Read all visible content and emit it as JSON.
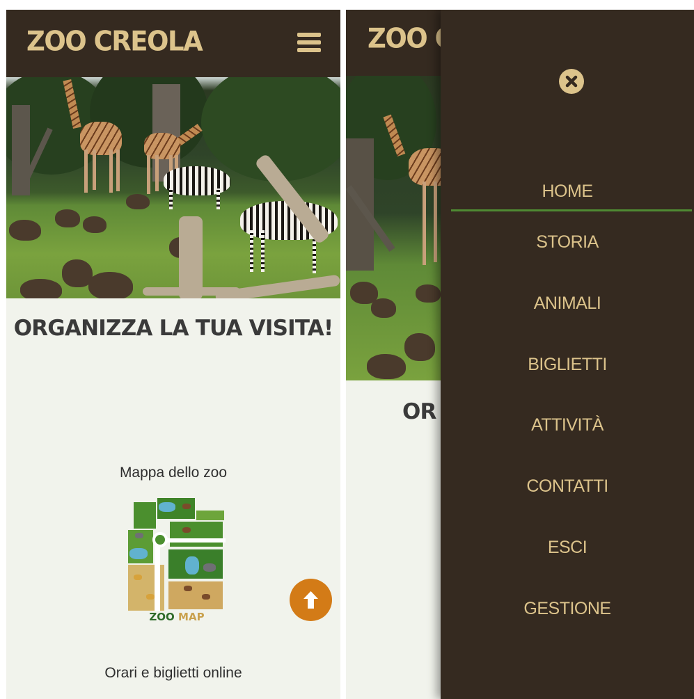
{
  "app": {
    "logo_text": "ZOO CREOLA",
    "colors": {
      "topbar": "#352a20",
      "brand_gold": "#dcc38b",
      "background": "#f1f3ec",
      "accent_orange": "#d37b17",
      "active_underline": "#4f8a33"
    }
  },
  "left_screen": {
    "menu_icon": "hamburger-icon",
    "hero_image": "giraffes-and-zebras-photo",
    "section_title": "ORGANIZZA LA TUA VISITA!",
    "links": [
      {
        "label": "Mappa dello zoo"
      },
      {
        "label": "Orari e biglietti online"
      }
    ],
    "zoo_map": {
      "caption_part1": "ZOO",
      "caption_part2": "MAP"
    },
    "scroll_top_icon": "arrow-up-icon"
  },
  "right_screen": {
    "section_title_visible": "OR",
    "drawer": {
      "close_icon": "close-icon",
      "active_item": "HOME",
      "items": [
        {
          "label": "HOME"
        },
        {
          "label": "STORIA"
        },
        {
          "label": "ANIMALI"
        },
        {
          "label": "BIGLIETTI"
        },
        {
          "label": "ATTIVITÀ"
        },
        {
          "label": "CONTATTI"
        },
        {
          "label": "ESCI"
        },
        {
          "label": "GESTIONE"
        }
      ]
    }
  }
}
